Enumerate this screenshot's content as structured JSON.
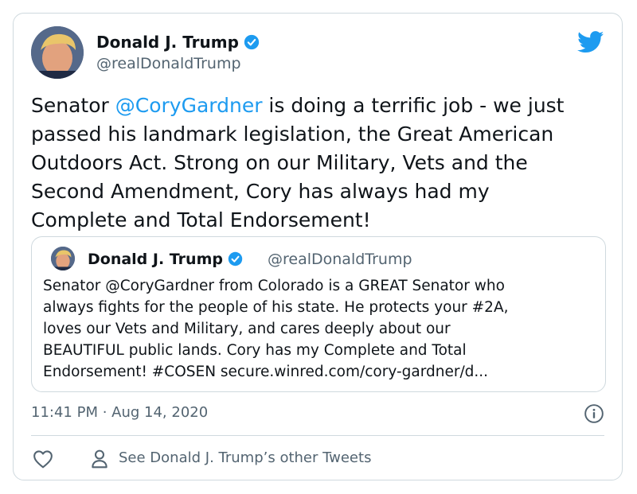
{
  "tweet": {
    "display_name": "Donald J. Trump",
    "handle": "@realDonaldTrump",
    "text_before_mention": "Senator ",
    "mention": "@CoryGardner",
    "text_after_mention": " is doing a terrific job - we just\npassed his landmark legislation, the Great American\nOutdoors Act. Strong on our Military, Vets and the\nSecond Amendment, Cory has always had my\nComplete and Total Endorsement!",
    "timestamp": "11:41 PM · Aug 14, 2020"
  },
  "quoted_tweet": {
    "display_name": "Donald J. Trump",
    "handle": "@realDonaldTrump",
    "text": "Senator @CoryGardner from Colorado is a GREAT Senator who\nalways fights for the people of his state. He protects your #2A,\nloves our Vets and Military, and cares deeply about our\nBEAUTIFUL public lands. Cory has my Complete and Total\nEndorsement! #COSEN secure.winred.com/cory-gardner/d..."
  },
  "actions": {
    "see_more_label": "See Donald J. Trump’s other Tweets"
  },
  "icons": {
    "logo": "twitter-bird-icon",
    "verified": "verified-badge-icon",
    "info": "info-icon",
    "like": "heart-icon",
    "profile": "person-icon"
  },
  "colors": {
    "accent": "#1d9bf0",
    "text": "#0f1419",
    "secondary_text": "#536471",
    "border": "#cfd9de"
  }
}
